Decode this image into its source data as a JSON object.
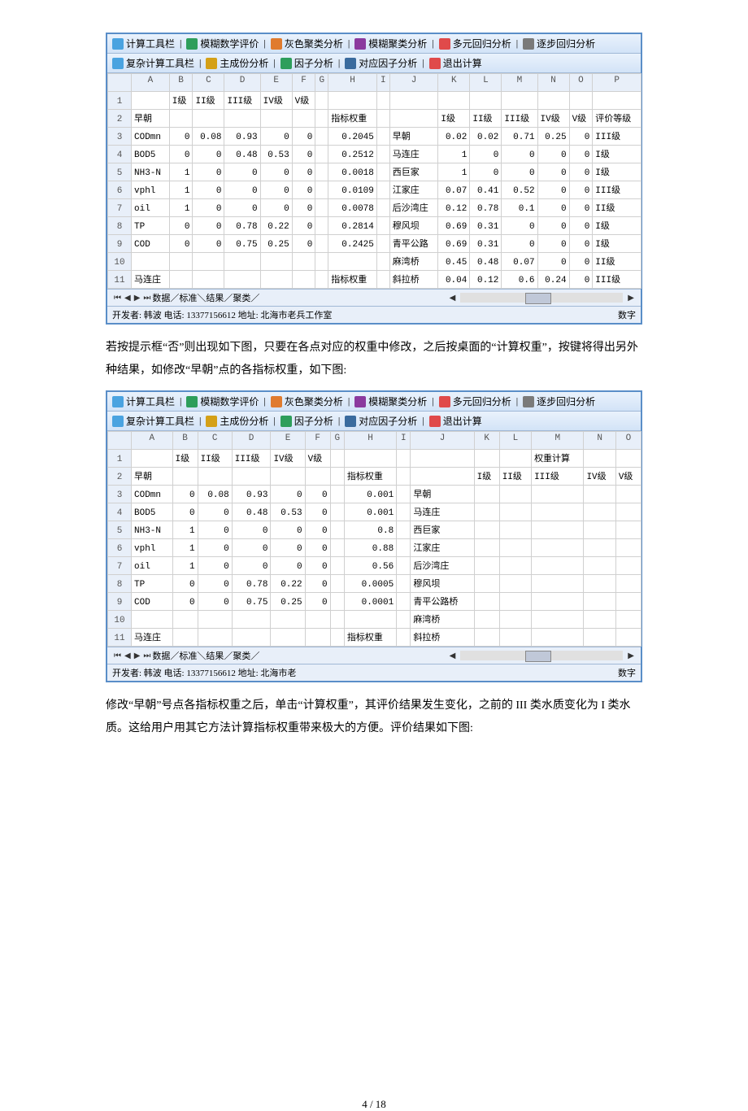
{
  "toolbar1": {
    "items": [
      "计算工具栏",
      "模糊数学评价",
      "灰色聚类分析",
      "模糊聚类分析",
      "多元回归分析",
      "逐步回归分析"
    ],
    "colors": [
      "#4aa3e0",
      "#2e9e5b",
      "#e07b2e",
      "#8b3a9e",
      "#e04a4a",
      "#7a7a7a"
    ]
  },
  "toolbar2": {
    "items": [
      "复杂计算工具栏",
      "主成份分析",
      "因子分析",
      "对应因子分析",
      "退出计算"
    ],
    "colors": [
      "#4aa3e0",
      "#d4a017",
      "#2e9e5b",
      "#3a6b9e",
      "#e04a4a"
    ]
  },
  "grid1": {
    "cols": [
      "A",
      "B",
      "C",
      "D",
      "E",
      "F",
      "G",
      "H",
      "I",
      "J",
      "K",
      "L",
      "M",
      "N",
      "O",
      "P"
    ],
    "rows": [
      [
        "",
        "I级",
        "II级",
        "III级",
        "IV级",
        "V级",
        "",
        "",
        "",
        "",
        "",
        "",
        "",
        "",
        "",
        ""
      ],
      [
        "早朝",
        "",
        "",
        "",
        "",
        "",
        "",
        "指标权重",
        "",
        "",
        "I级",
        "II级",
        "III级",
        "IV级",
        "V级",
        "评价等级"
      ],
      [
        "CODmn",
        "0",
        "0.08",
        "0.93",
        "0",
        "0",
        "",
        "0.2045",
        "",
        "早朝",
        "0.02",
        "0.02",
        "0.71",
        "0.25",
        "0",
        "III级"
      ],
      [
        "BOD5",
        "0",
        "0",
        "0.48",
        "0.53",
        "0",
        "",
        "0.2512",
        "",
        "马连庄",
        "1",
        "0",
        "0",
        "0",
        "0",
        "I级"
      ],
      [
        "NH3-N",
        "1",
        "0",
        "0",
        "0",
        "0",
        "",
        "0.0018",
        "",
        "西巨家",
        "1",
        "0",
        "0",
        "0",
        "0",
        "I级"
      ],
      [
        "vphl",
        "1",
        "0",
        "0",
        "0",
        "0",
        "",
        "0.0109",
        "",
        "江家庄",
        "0.07",
        "0.41",
        "0.52",
        "0",
        "0",
        "III级"
      ],
      [
        "oil",
        "1",
        "0",
        "0",
        "0",
        "0",
        "",
        "0.0078",
        "",
        "后沙湾庄",
        "0.12",
        "0.78",
        "0.1",
        "0",
        "0",
        "II级"
      ],
      [
        "TP",
        "0",
        "0",
        "0.78",
        "0.22",
        "0",
        "",
        "0.2814",
        "",
        "穆风坝",
        "0.69",
        "0.31",
        "0",
        "0",
        "0",
        "I级"
      ],
      [
        "COD",
        "0",
        "0",
        "0.75",
        "0.25",
        "0",
        "",
        "0.2425",
        "",
        "青平公路",
        "0.69",
        "0.31",
        "0",
        "0",
        "0",
        "I级"
      ],
      [
        "",
        "",
        "",
        "",
        "",
        "",
        "",
        "",
        "",
        "麻湾桥",
        "0.45",
        "0.48",
        "0.07",
        "0",
        "0",
        "II级"
      ],
      [
        "马连庄",
        "",
        "",
        "",
        "",
        "",
        "",
        "指标权重",
        "",
        "斜拉桥",
        "0.04",
        "0.12",
        "0.6",
        "0.24",
        "0",
        "III级"
      ]
    ]
  },
  "grid2": {
    "cols": [
      "A",
      "B",
      "C",
      "D",
      "E",
      "F",
      "G",
      "H",
      "I",
      "J",
      "K",
      "L",
      "M",
      "N",
      "O"
    ],
    "rows": [
      [
        "",
        "I级",
        "II级",
        "III级",
        "IV级",
        "V级",
        "",
        "",
        "",
        "",
        "",
        "",
        "权重计算",
        "",
        ""
      ],
      [
        "早朝",
        "",
        "",
        "",
        "",
        "",
        "",
        "指标权重",
        "",
        "",
        "I级",
        "II级",
        "III级",
        "IV级",
        "V级"
      ],
      [
        "CODmn",
        "0",
        "0.08",
        "0.93",
        "0",
        "0",
        "",
        "0.001",
        "",
        "早朝",
        "",
        "",
        "",
        "",
        ""
      ],
      [
        "BOD5",
        "0",
        "0",
        "0.48",
        "0.53",
        "0",
        "",
        "0.001",
        "",
        "马连庄",
        "",
        "",
        "",
        "",
        ""
      ],
      [
        "NH3-N",
        "1",
        "0",
        "0",
        "0",
        "0",
        "",
        "0.8",
        "",
        "西巨家",
        "",
        "",
        "",
        "",
        ""
      ],
      [
        "vphl",
        "1",
        "0",
        "0",
        "0",
        "0",
        "",
        "0.88",
        "",
        "江家庄",
        "",
        "",
        "",
        "",
        ""
      ],
      [
        "oil",
        "1",
        "0",
        "0",
        "0",
        "0",
        "",
        "0.56",
        "",
        "后沙湾庄",
        "",
        "",
        "",
        "",
        ""
      ],
      [
        "TP",
        "0",
        "0",
        "0.78",
        "0.22",
        "0",
        "",
        "0.0005",
        "",
        "穆风坝",
        "",
        "",
        "",
        "",
        ""
      ],
      [
        "COD",
        "0",
        "0",
        "0.75",
        "0.25",
        "0",
        "",
        "0.0001",
        "",
        "青平公路桥",
        "",
        "",
        "",
        "",
        ""
      ],
      [
        "",
        "",
        "",
        "",
        "",
        "",
        "",
        "",
        "",
        "麻湾桥",
        "",
        "",
        "",
        "",
        ""
      ],
      [
        "马连庄",
        "",
        "",
        "",
        "",
        "",
        "",
        "指标权重",
        "",
        "斜拉桥",
        "",
        "",
        "",
        "",
        ""
      ]
    ]
  },
  "sheettabs": "数据／标准＼结果／聚类／",
  "status1": "开发者: 韩波  电话: 13377156612  地址: 北海市老兵工作室",
  "status2": "开发者: 韩波  电话: 13377156612  地址: 北海市老",
  "status_right": "数字",
  "para1": "若按提示框“否”则出现如下图，只要在各点对应的权重中修改，之后按桌面的“计算权重”，按键将得出另外种结果，如修改“早朝”点的各指标权重，如下图:",
  "para2": "修改“早朝”号点各指标权重之后，单击“计算权重”，其评价结果发生变化，之前的 III 类水质变化为 I 类水质。这给用户用其它方法计算指标权重带来极大的方便。评价结果如下图:",
  "pagenum": "4 / 18"
}
